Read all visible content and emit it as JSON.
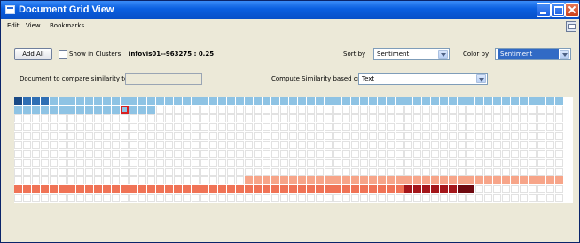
{
  "window": {
    "title": "Document Grid View"
  },
  "menu": {
    "items": [
      "Edit",
      "View",
      "Bookmarks"
    ]
  },
  "toolbar": {
    "add_all_label": "Add All",
    "show_in_clusters_label": "Show in Clusters",
    "show_in_clusters_checked": false,
    "status_readout": "infovis01--963275 : 0.25",
    "sort_by_label": "Sort by",
    "sort_by_value": "Sentiment",
    "color_by_label": "Color by",
    "color_by_value": "Sentiment"
  },
  "compare": {
    "document_label": "Document to compare similarity to",
    "document_value": "",
    "compute_label": "Compute Similarity based on",
    "compute_value": "Text"
  },
  "colors": {
    "cell_empty": "#ffffff",
    "blue_dark": "#1a4a86",
    "blue_mid": "#2f6fb4",
    "blue_light": "#8ec3e4",
    "orange_light": "#f7a589",
    "orange_mid": "#f07356",
    "red_dark": "#a4161a",
    "red_darkest": "#6f0a10",
    "selection": "#d82020"
  },
  "grid": {
    "rows": 12,
    "cols": 62,
    "row_bands": [
      {
        "row": 0,
        "segments": [
          {
            "from": 0,
            "to": 0,
            "color": "blue_dark"
          },
          {
            "from": 1,
            "to": 3,
            "color": "blue_mid"
          },
          {
            "from": 4,
            "to": 61,
            "color": "blue_light"
          }
        ]
      },
      {
        "row": 1,
        "segments": [
          {
            "from": 0,
            "to": 15,
            "color": "blue_light"
          }
        ]
      },
      {
        "row": 9,
        "segments": [
          {
            "from": 26,
            "to": 61,
            "color": "orange_light"
          }
        ]
      },
      {
        "row": 10,
        "segments": [
          {
            "from": 0,
            "to": 43,
            "color": "orange_mid"
          },
          {
            "from": 44,
            "to": 49,
            "color": "red_dark"
          },
          {
            "from": 50,
            "to": 51,
            "color": "red_darkest"
          }
        ]
      }
    ],
    "selected_cell": {
      "row": 1,
      "col": 12
    }
  }
}
